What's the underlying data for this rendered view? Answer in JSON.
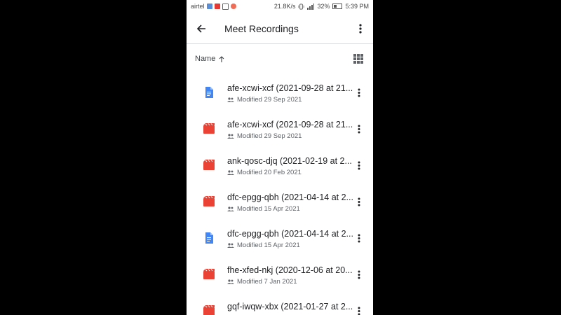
{
  "status_bar": {
    "carrier": "airtel",
    "speed": "21.8K/s",
    "battery": "32%",
    "time": "5:39 PM"
  },
  "app_bar": {
    "title": "Meet Recordings"
  },
  "sort": {
    "label": "Name"
  },
  "colors": {
    "doc_blue": "#4285f4",
    "video_red": "#ea4335",
    "text_primary": "#202124",
    "text_secondary": "#5f6368"
  },
  "files": [
    {
      "name": "afe-xcwi-xcf (2021-09-28 at 21...",
      "modified": "Modified 29 Sep 2021",
      "type": "doc"
    },
    {
      "name": "afe-xcwi-xcf (2021-09-28 at 21...",
      "modified": "Modified 29 Sep 2021",
      "type": "video"
    },
    {
      "name": "ank-qosc-djq (2021-02-19 at 2...",
      "modified": "Modified 20 Feb 2021",
      "type": "video"
    },
    {
      "name": "dfc-epgg-qbh (2021-04-14 at 2...",
      "modified": "Modified 15 Apr 2021",
      "type": "video"
    },
    {
      "name": "dfc-epgg-qbh (2021-04-14 at 2...",
      "modified": "Modified 15 Apr 2021",
      "type": "doc"
    },
    {
      "name": "fhe-xfed-nkj (2020-12-06 at 20...",
      "modified": "Modified 7 Jan 2021",
      "type": "video"
    },
    {
      "name": "gqf-iwqw-xbx (2021-01-27 at 2...",
      "modified": "",
      "type": "video"
    }
  ]
}
